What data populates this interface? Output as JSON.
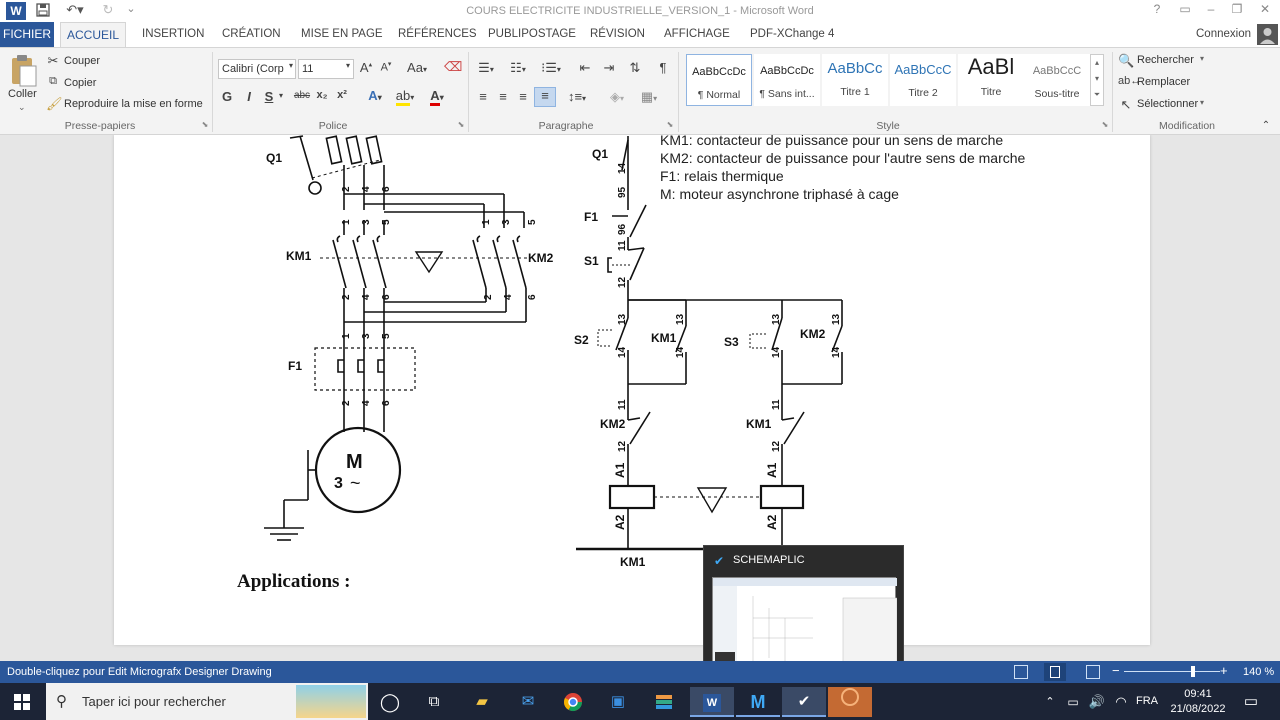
{
  "window": {
    "title": "COURS ELECTRICITE INDUSTRIELLE_VERSION_1 - Microsoft Word",
    "signin": "Connexion"
  },
  "titlebar_icons": {
    "word": "W",
    "save": "save-icon",
    "undo": "undo-icon",
    "redo": "redo-icon",
    "help": "?",
    "restore": "ribbon-display-icon",
    "minimize": "–",
    "maximize": "❐",
    "close": "✕"
  },
  "tabs": [
    "FICHIER",
    "ACCUEIL",
    "INSERTION",
    "CRÉATION",
    "MISE EN PAGE",
    "RÉFÉRENCES",
    "PUBLIPOSTAGE",
    "RÉVISION",
    "AFFICHAGE",
    "PDF-XChange 4"
  ],
  "clipboard": {
    "paste": "Coller",
    "cut": "Couper",
    "copy": "Copier",
    "format_painter": "Reproduire la mise en forme",
    "label": "Presse-papiers"
  },
  "font": {
    "name": "Calibri (Corp",
    "size": "11",
    "label": "Police",
    "bold": "G",
    "italic": "I",
    "underline": "S",
    "strike": "abc",
    "sub": "x₂",
    "sup": "x²"
  },
  "paragraph": {
    "label": "Paragraphe",
    "pilcrow": "¶"
  },
  "styles": {
    "label": "Style",
    "items": [
      {
        "preview": "AaBbCcDc",
        "name": "¶ Normal"
      },
      {
        "preview": "AaBbCcDc",
        "name": "¶ Sans int..."
      },
      {
        "preview": "AaBbCc",
        "name": "Titre 1"
      },
      {
        "preview": "AaBbCcC",
        "name": "Titre 2"
      },
      {
        "preview": "AaBl",
        "name": "Titre"
      },
      {
        "preview": "AaBbCcC",
        "name": "Sous-titre"
      }
    ]
  },
  "editing": {
    "find": "Rechercher",
    "replace": "Remplacer",
    "select": "Sélectionner",
    "label": "Modification"
  },
  "doc": {
    "legend": [
      "KM1: contacteur de puissance pour un sens de marche",
      "KM2: contacteur de puissance pour l'autre sens de marche",
      "F1: relais thermique",
      "M: moteur asynchrone triphasé à cage"
    ],
    "power": {
      "q1": "Q1",
      "km1": "KM1",
      "km2": "KM2",
      "f1": "F1",
      "motor": "M",
      "motor_sub": "3",
      "motor_ac": "~",
      "t1": "1",
      "t3": "3",
      "t5": "5",
      "t2": "2",
      "t4": "4",
      "t6": "6"
    },
    "control": {
      "q1": "Q1",
      "f1": "F1",
      "s1": "S1",
      "s2": "S2",
      "s3": "S3",
      "km1": "KM1",
      "km2": "KM2",
      "a1": "A1",
      "a2": "A2",
      "n14": "14",
      "n95": "95",
      "n96": "96",
      "n11": "11",
      "n12": "12",
      "n13": "13"
    },
    "applications": "Applications :"
  },
  "thumbnail": {
    "title": "SCHEMAPLIC"
  },
  "status": {
    "left": "Double-cliquez pour Edit Micrografx Designer Drawing",
    "zoom": "140 %",
    "zoom_minus": "−",
    "zoom_plus": "+",
    "zoom_level": 0.72
  },
  "taskbar": {
    "search": "Taper ici pour rechercher",
    "lang": "FRA",
    "time": "09:41",
    "date": "21/08/2022"
  }
}
